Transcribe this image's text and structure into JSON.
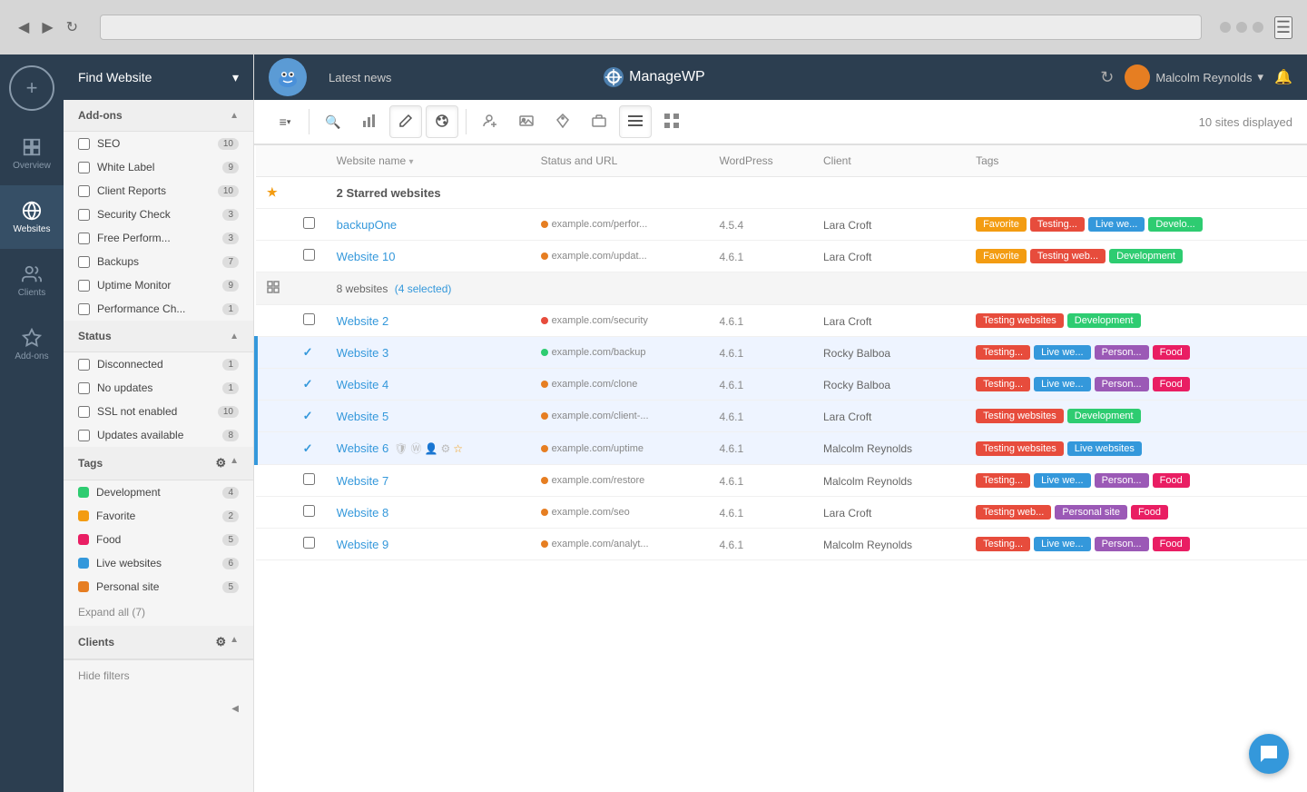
{
  "browser": {
    "dots": [
      "red-dot",
      "yellow-dot",
      "green-dot"
    ],
    "hamburger_label": "☰"
  },
  "sidebar_icons": [
    {
      "id": "add",
      "icon": "+",
      "label": ""
    },
    {
      "id": "overview",
      "icon": "▤",
      "label": "Overview",
      "active": false
    },
    {
      "id": "websites",
      "icon": "🌐",
      "label": "Websites",
      "active": true
    },
    {
      "id": "clients",
      "icon": "👤",
      "label": "Clients",
      "active": false
    },
    {
      "id": "addons",
      "icon": "⭐",
      "label": "Add-ons",
      "active": false
    }
  ],
  "find_website": {
    "label": "Find Website",
    "arrow": "▾"
  },
  "addons_section": {
    "label": "Add-ons",
    "items": [
      {
        "label": "SEO",
        "count": 10
      },
      {
        "label": "White Label",
        "count": 9
      },
      {
        "label": "Client Reports",
        "count": 10
      },
      {
        "label": "Security Check",
        "count": 3
      },
      {
        "label": "Free Perform...",
        "count": 3
      },
      {
        "label": "Backups",
        "count": 7
      },
      {
        "label": "Uptime Monitor",
        "count": 9
      },
      {
        "label": "Performance Ch...",
        "count": 1
      }
    ]
  },
  "status_section": {
    "label": "Status",
    "items": [
      {
        "label": "Disconnected",
        "count": 1
      },
      {
        "label": "No updates",
        "count": 1
      },
      {
        "label": "SSL not enabled",
        "count": 10
      },
      {
        "label": "Updates available",
        "count": 8
      }
    ]
  },
  "tags_section": {
    "label": "Tags",
    "items": [
      {
        "label": "Development",
        "count": 4,
        "color": "#2ecc71"
      },
      {
        "label": "Favorite",
        "count": 2,
        "color": "#f39c12"
      },
      {
        "label": "Food",
        "count": 5,
        "color": "#e91e63"
      },
      {
        "label": "Live websites",
        "count": 6,
        "color": "#3498db"
      },
      {
        "label": "Personal site",
        "count": 5,
        "color": "#e67e22"
      }
    ],
    "expand_label": "Expand all (7)"
  },
  "clients_section": {
    "label": "Clients"
  },
  "hide_filters": "Hide filters",
  "collapse_arrow": "◀",
  "header": {
    "latest_news": "Latest news",
    "logo_text": "ManageWP",
    "user_name": "Malcolm Reynolds",
    "user_arrow": "▾"
  },
  "toolbar": {
    "sites_displayed": "10 sites displayed",
    "buttons": [
      {
        "id": "filter-dropdown",
        "icon": "≡",
        "active": false
      },
      {
        "id": "search",
        "icon": "🔍",
        "active": false
      },
      {
        "id": "bar-chart",
        "icon": "📊",
        "active": false
      },
      {
        "id": "edit-pen",
        "icon": "✏️",
        "active": true
      },
      {
        "id": "palette",
        "icon": "🎨",
        "active": true
      },
      {
        "id": "person-add",
        "icon": "👤+",
        "active": false
      },
      {
        "id": "image",
        "icon": "🖼",
        "active": false
      },
      {
        "id": "tag",
        "icon": "🏷",
        "active": false
      },
      {
        "id": "briefcase",
        "icon": "💼",
        "active": false
      }
    ],
    "view_list": "≡",
    "view_grid": "⊞"
  },
  "table": {
    "columns": [
      "",
      "",
      "Website name",
      "Status and URL",
      "WordPress",
      "Client",
      "Tags"
    ],
    "starred_group": {
      "label": "2 Starred websites"
    },
    "websites_group": {
      "label": "8 websites",
      "selected_label": "(4 selected)"
    },
    "rows": [
      {
        "id": "backupOne",
        "name": "backupOne",
        "url": "example.com/perfor...",
        "status": "orange",
        "wp": "4.5.4",
        "client": "Lara Croft",
        "tags": [
          {
            "label": "Favorite",
            "class": "tag-favorite"
          },
          {
            "label": "Testing...",
            "class": "tag-testing"
          },
          {
            "label": "Live we...",
            "class": "tag-live"
          },
          {
            "label": "Develo...",
            "class": "tag-development"
          }
        ],
        "starred": true,
        "checked": false,
        "selected": false,
        "group": "starred"
      },
      {
        "id": "website10",
        "name": "Website 10",
        "url": "example.com/updat...",
        "status": "orange",
        "wp": "4.6.1",
        "client": "Lara Croft",
        "tags": [
          {
            "label": "Favorite",
            "class": "tag-favorite"
          },
          {
            "label": "Testing web...",
            "class": "tag-testing"
          },
          {
            "label": "Development",
            "class": "tag-development"
          }
        ],
        "starred": false,
        "checked": false,
        "selected": false,
        "group": "starred"
      },
      {
        "id": "website2",
        "name": "Website 2",
        "url": "example.com/security",
        "status": "red",
        "wp": "4.6.1",
        "client": "Lara Croft",
        "tags": [
          {
            "label": "Testing websites",
            "class": "tag-testing"
          },
          {
            "label": "Development",
            "class": "tag-development"
          }
        ],
        "starred": false,
        "checked": false,
        "selected": false,
        "group": "main"
      },
      {
        "id": "website3",
        "name": "Website 3",
        "url": "example.com/backup",
        "status": "green",
        "wp": "4.6.1",
        "client": "Rocky Balboa",
        "tags": [
          {
            "label": "Testing...",
            "class": "tag-testing"
          },
          {
            "label": "Live we...",
            "class": "tag-live"
          },
          {
            "label": "Person...",
            "class": "tag-personal"
          },
          {
            "label": "Food",
            "class": "tag-food"
          }
        ],
        "starred": false,
        "checked": true,
        "selected": true,
        "group": "main"
      },
      {
        "id": "website4",
        "name": "Website 4",
        "url": "example.com/clone",
        "status": "orange",
        "wp": "4.6.1",
        "client": "Rocky Balboa",
        "tags": [
          {
            "label": "Testing...",
            "class": "tag-testing"
          },
          {
            "label": "Live we...",
            "class": "tag-live"
          },
          {
            "label": "Person...",
            "class": "tag-personal"
          },
          {
            "label": "Food",
            "class": "tag-food"
          }
        ],
        "starred": false,
        "checked": true,
        "selected": true,
        "group": "main"
      },
      {
        "id": "website5",
        "name": "Website 5",
        "url": "example.com/client-...",
        "status": "orange",
        "wp": "4.6.1",
        "client": "Lara Croft",
        "tags": [
          {
            "label": "Testing websites",
            "class": "tag-testing"
          },
          {
            "label": "Development",
            "class": "tag-development"
          }
        ],
        "starred": false,
        "checked": true,
        "selected": true,
        "group": "main"
      },
      {
        "id": "website6",
        "name": "Website 6",
        "url": "example.com/uptime",
        "status": "orange",
        "wp": "4.6.1",
        "client": "Malcolm Reynolds",
        "tags": [
          {
            "label": "Testing websites",
            "class": "tag-testing"
          },
          {
            "label": "Live websites",
            "class": "tag-live"
          }
        ],
        "starred": false,
        "checked": true,
        "selected": true,
        "has_mini_icons": true,
        "group": "main"
      },
      {
        "id": "website7",
        "name": "Website 7",
        "url": "example.com/restore",
        "status": "orange",
        "wp": "4.6.1",
        "client": "Malcolm Reynolds",
        "tags": [
          {
            "label": "Testing...",
            "class": "tag-testing"
          },
          {
            "label": "Live we...",
            "class": "tag-live"
          },
          {
            "label": "Person...",
            "class": "tag-personal"
          },
          {
            "label": "Food",
            "class": "tag-food"
          }
        ],
        "starred": false,
        "checked": false,
        "selected": false,
        "group": "main"
      },
      {
        "id": "website8",
        "name": "Website 8",
        "url": "example.com/seo",
        "status": "orange",
        "wp": "4.6.1",
        "client": "Lara Croft",
        "tags": [
          {
            "label": "Testing web...",
            "class": "tag-testing"
          },
          {
            "label": "Personal site",
            "class": "tag-personal"
          },
          {
            "label": "Food",
            "class": "tag-food"
          }
        ],
        "starred": false,
        "checked": false,
        "selected": false,
        "group": "main"
      },
      {
        "id": "website9",
        "name": "Website 9",
        "url": "example.com/analyt...",
        "status": "orange",
        "wp": "4.6.1",
        "client": "Malcolm Reynolds",
        "tags": [
          {
            "label": "Testing...",
            "class": "tag-testing"
          },
          {
            "label": "Live we...",
            "class": "tag-live"
          },
          {
            "label": "Person...",
            "class": "tag-personal"
          },
          {
            "label": "Food",
            "class": "tag-food"
          }
        ],
        "starred": false,
        "checked": false,
        "selected": false,
        "group": "main"
      }
    ]
  },
  "chat_icon": "💬"
}
